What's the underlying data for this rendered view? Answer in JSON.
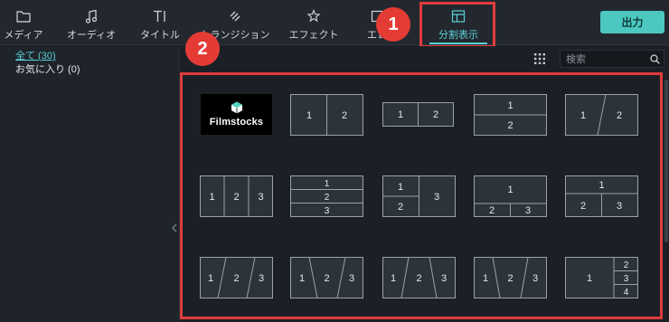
{
  "toolbar": {
    "items": [
      {
        "label": "メディア",
        "icon": "folder-icon"
      },
      {
        "label": "オーディオ",
        "icon": "music-note-icon"
      },
      {
        "label": "タイトル",
        "icon": "title-text-icon"
      },
      {
        "label": "トランジション",
        "icon": "transition-icon"
      },
      {
        "label": "エフェクト",
        "icon": "effect-sparkle-icon"
      },
      {
        "label": "エレ",
        "icon": "element-icon"
      },
      {
        "label": "分割表示",
        "icon": "split-screen-icon",
        "active": true
      }
    ],
    "export_label": "出力"
  },
  "annotations": {
    "badge1": "1",
    "badge2": "2",
    "highlight_color": "#e03c3c"
  },
  "sidebar": {
    "items": [
      {
        "label": "全て (30)",
        "selected": true
      },
      {
        "label": "お気に入り (0)",
        "selected": false
      }
    ]
  },
  "search": {
    "placeholder": "検索",
    "value": ""
  },
  "content": {
    "filmstocks_label": "Filmstocks",
    "templates": [
      {
        "name": "split-2-vertical",
        "labels": [
          "1",
          "2"
        ]
      },
      {
        "name": "split-2-vertical-wide",
        "labels": [
          "1",
          "2"
        ]
      },
      {
        "name": "split-2-horizontal",
        "labels": [
          "1",
          "2"
        ]
      },
      {
        "name": "split-2-diagonal",
        "labels": [
          "1",
          "2"
        ]
      },
      {
        "name": "split-3-vertical",
        "labels": [
          "1",
          "2",
          "3"
        ]
      },
      {
        "name": "split-3-horizontal",
        "labels": [
          "1",
          "2",
          "3"
        ]
      },
      {
        "name": "split-3-left-stack",
        "labels": [
          "1",
          "2",
          "3"
        ]
      },
      {
        "name": "split-3-top-wide",
        "labels": [
          "1",
          "2",
          "3"
        ]
      },
      {
        "name": "split-3-top-wide-b",
        "labels": [
          "1",
          "2",
          "3"
        ]
      },
      {
        "name": "split-3-diagonal-a",
        "labels": [
          "1",
          "2",
          "3"
        ]
      },
      {
        "name": "split-3-diagonal-b",
        "labels": [
          "1",
          "2",
          "3"
        ]
      },
      {
        "name": "split-3-diagonal-c",
        "labels": [
          "1",
          "2",
          "3"
        ]
      },
      {
        "name": "split-3-diagonal-d",
        "labels": [
          "1",
          "2",
          "3"
        ]
      },
      {
        "name": "split-4-right-stack",
        "labels": [
          "1",
          "2",
          "3",
          "4"
        ]
      }
    ]
  },
  "colors": {
    "accent": "#5ad0d6",
    "export_button": "#4cc8c0",
    "tile_fill": "#2d333b",
    "tile_stroke": "#9aa1aa"
  }
}
